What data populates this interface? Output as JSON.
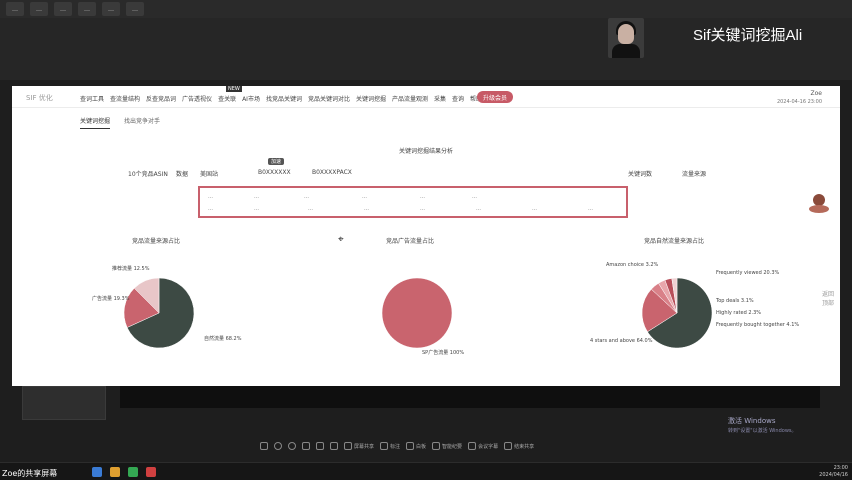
{
  "top_tabs": [
    "…",
    "…",
    "…",
    "…",
    "…",
    "…"
  ],
  "brand_text": "Sif关键词",
  "brand_suffix": "挖掘Ali",
  "window": {
    "logo": "SIF 优化",
    "nav": [
      "查词工具",
      "查流量结构",
      "反查竞品词",
      "广告透视仪",
      "查关联",
      "AI市场",
      "找竞品关键词",
      "竞品关键词对比",
      "关键词挖掘",
      "产品流量观测",
      "采集",
      "查询",
      "帮助"
    ],
    "nav_pill": "升级会员",
    "new_badge": "NEW",
    "user_name": "Zoe",
    "user_date": "2024-04-16 23:00",
    "subtabs": [
      "关键词挖掘",
      "找出竞争对手"
    ],
    "section_title": "关键词挖掘结果分析",
    "mini_tag": "加速",
    "info": [
      "10个竞品ASIN",
      "数据",
      "美国站",
      "B0XXXXXX",
      "B0XXXXPACX",
      "关键词数",
      "流量来源"
    ],
    "keywords_row1": [
      "…",
      "…",
      "…",
      "…",
      "…",
      "…"
    ],
    "keywords_row2": [
      "…",
      "…",
      "…",
      "…",
      "…",
      "…",
      "…",
      "…"
    ],
    "charts": [
      {
        "title": "竞品流量来源占比"
      },
      {
        "title": "竞品广告流量占比"
      },
      {
        "title": "竞品自然流量来源占比"
      }
    ],
    "pie1_labels": [
      "推荐流量 12.5%",
      "广告流量 19.3%",
      "自然流量 68.2%"
    ],
    "pie2_labels": [
      "SP广告流量 100%"
    ],
    "pie3_labels": [
      "Amazon choice 3.2%",
      "Frequently viewed 20.3%",
      "Top deals 3.1%",
      "Highly rated 2.3%",
      "Frequently bought together 4.1%",
      "4 stars and above 64.0%"
    ],
    "vstrip": "返回顶部"
  },
  "activate": {
    "line1": "激活 Windows",
    "line2": "转到\"设置\"以激活 Windows。"
  },
  "meeting_bar": [
    "",
    "",
    "",
    "",
    "",
    "",
    "",
    "",
    "屏幕共享",
    "标注",
    "白板",
    "",
    "智能纪要",
    "会议字幕",
    "",
    "结束共享"
  ],
  "taskbar_name": "Zoe的共享屏幕",
  "tray_time": "23:00",
  "tray_date": "2024/04/16",
  "chart_data": [
    {
      "type": "pie",
      "title": "竞品流量来源占比",
      "slices": [
        {
          "label": "自然流量",
          "value": 68.2,
          "color": "#3d4a44"
        },
        {
          "label": "广告流量",
          "value": 19.3,
          "color": "#c9646e"
        },
        {
          "label": "推荐流量",
          "value": 12.5,
          "color": "#e8c6c8"
        }
      ]
    },
    {
      "type": "pie",
      "title": "竞品广告流量占比",
      "slices": [
        {
          "label": "SP广告流量",
          "value": 100,
          "color": "#c9646e"
        }
      ]
    },
    {
      "type": "pie",
      "title": "竞品自然流量来源占比",
      "slices": [
        {
          "label": "4 stars and above",
          "value": 64.0,
          "color": "#3d4a44"
        },
        {
          "label": "Frequently viewed",
          "value": 20.3,
          "color": "#c9646e"
        },
        {
          "label": "Frequently bought together",
          "value": 4.1,
          "color": "#d98088"
        },
        {
          "label": "Amazon choice",
          "value": 3.2,
          "color": "#e8a6ab"
        },
        {
          "label": "Top deals",
          "value": 3.1,
          "color": "#b84f5a"
        },
        {
          "label": "Highly rated",
          "value": 2.3,
          "color": "#f0d0d2"
        }
      ]
    }
  ]
}
